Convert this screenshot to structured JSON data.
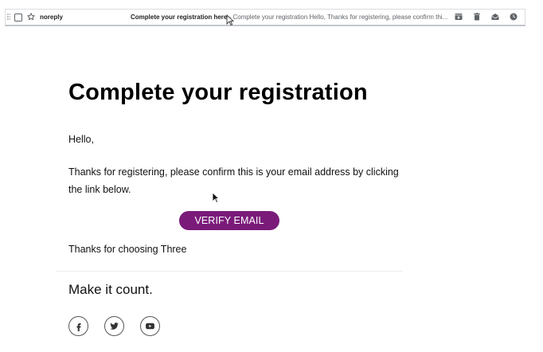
{
  "inbox_row": {
    "sender": "noreply",
    "subject": "Complete your registration here",
    "separator": " - ",
    "snippet": "Complete your registration Hello, Thanks for registering, please confirm thi..."
  },
  "email": {
    "title": "Complete your registration",
    "greeting": "Hello,",
    "body": "Thanks for registering, please confirm this is your email address by clicking the link below.",
    "button_label": "VERIFY EMAIL",
    "closing": "Thanks for choosing Three",
    "tagline": "Make it count.",
    "socials": [
      {
        "icon": "facebook-icon"
      },
      {
        "icon": "twitter-icon"
      },
      {
        "icon": "youtube-icon"
      }
    ]
  },
  "colors": {
    "button": "#7a1b7a",
    "button_text": "#ffffff",
    "text": "#111111",
    "muted": "#5f6368"
  }
}
